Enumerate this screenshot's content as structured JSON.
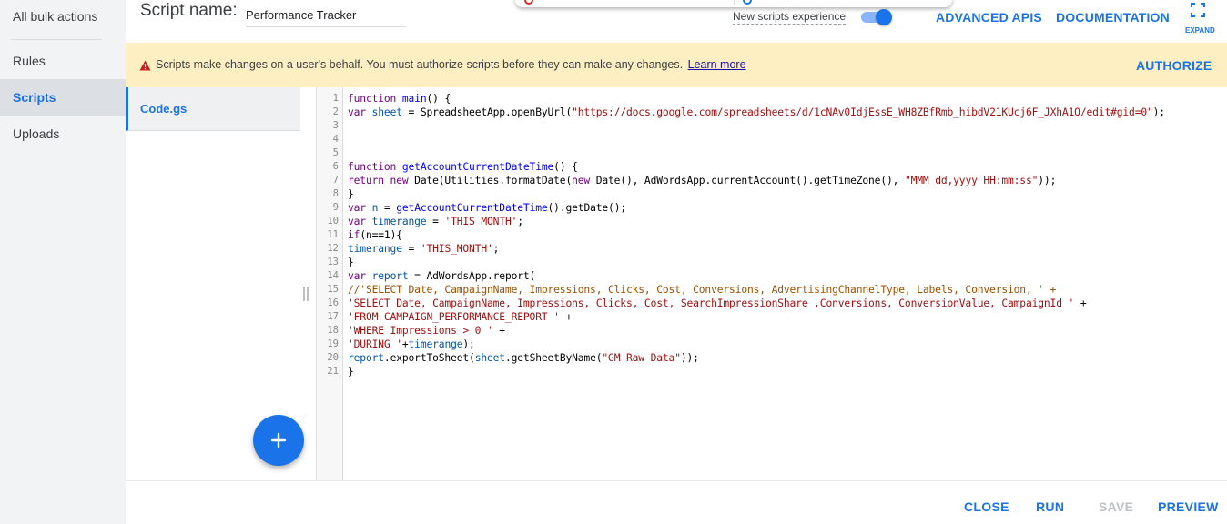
{
  "nav": {
    "items": [
      {
        "label": "All bulk actions",
        "active": false
      },
      {
        "label": "Rules",
        "active": false
      },
      {
        "label": "Scripts",
        "active": true
      },
      {
        "label": "Uploads",
        "active": false
      }
    ]
  },
  "header": {
    "script_name_label": "Script name:",
    "script_name_value": "Performance Tracker",
    "new_scripts_label": "New scripts experience",
    "new_scripts_enabled": true,
    "advanced_apis": "ADVANCED APIS",
    "documentation": "DOCUMENTATION",
    "expand_label": "EXPAND",
    "expand_icon": "fullscreen-icon"
  },
  "banner": {
    "icon": "warning-icon",
    "text": "Scripts make changes on a user's behalf. You must authorize scripts before they can make any changes.",
    "link": "Learn more",
    "authorize": "AUTHORIZE",
    "background": "#feefc3"
  },
  "files": {
    "items": [
      {
        "name": "Code.gs",
        "active": true
      }
    ],
    "add_icon": "plus-icon"
  },
  "editor": {
    "lines": [
      [
        [
          "function ",
          "k"
        ],
        [
          "main",
          "f"
        ],
        [
          "() {",
          "p"
        ]
      ],
      [
        [
          "var ",
          "k"
        ],
        [
          "sheet",
          "v"
        ],
        [
          " = SpreadsheetApp.openByUrl(",
          "p"
        ],
        [
          "\"https://docs.google.com/spreadsheets/d/1cNAv0IdjEssE_WH8ZBfRmb_hibdV21KUcj6F_JXhA1Q/edit#gid=0\"",
          "s"
        ],
        [
          ");",
          "p"
        ]
      ],
      [],
      [],
      [],
      [
        [
          "function ",
          "k"
        ],
        [
          "getAccountCurrentDateTime",
          "f"
        ],
        [
          "() {",
          "p"
        ]
      ],
      [
        [
          "return new ",
          "k"
        ],
        [
          "Date(Utilities.formatDate(",
          "p"
        ],
        [
          "new ",
          "k"
        ],
        [
          "Date(), AdWordsApp.currentAccount().getTimeZone(), ",
          "p"
        ],
        [
          "\"MMM dd,yyyy HH:mm:ss\"",
          "s"
        ],
        [
          "));",
          "p"
        ]
      ],
      [
        [
          "}",
          "p"
        ]
      ],
      [
        [
          "var ",
          "k"
        ],
        [
          "n",
          "v"
        ],
        [
          " = ",
          "p"
        ],
        [
          "getAccountCurrentDateTime",
          "f"
        ],
        [
          "().getDate();",
          "p"
        ]
      ],
      [
        [
          "var ",
          "k"
        ],
        [
          "timerange",
          "v"
        ],
        [
          " = ",
          "p"
        ],
        [
          "'THIS_MONTH'",
          "s"
        ],
        [
          ";",
          "p"
        ]
      ],
      [
        [
          "if",
          "k"
        ],
        [
          "(n==1){",
          "p"
        ]
      ],
      [
        [
          "timerange",
          "v"
        ],
        [
          " = ",
          "p"
        ],
        [
          "'THIS_MONTH'",
          "s"
        ],
        [
          ";",
          "p"
        ]
      ],
      [
        [
          "}",
          "p"
        ]
      ],
      [
        [
          "var ",
          "k"
        ],
        [
          "report",
          "v"
        ],
        [
          " = AdWordsApp.report(",
          "p"
        ]
      ],
      [
        [
          "//'SELECT Date, CampaignName, Impressions, Clicks, Cost, Conversions, AdvertisingChannelType, Labels, Conversion, ' +",
          "c"
        ]
      ],
      [
        [
          "'SELECT Date, CampaignName, Impressions, Clicks, Cost, SearchImpressionShare ,Conversions, ConversionValue, CampaignId '",
          "s"
        ],
        [
          " +",
          "p"
        ]
      ],
      [
        [
          "'FROM CAMPAIGN_PERFORMANCE_REPORT '",
          "s"
        ],
        [
          " +",
          "p"
        ]
      ],
      [
        [
          "'WHERE Impressions > 0 '",
          "s"
        ],
        [
          " +",
          "p"
        ]
      ],
      [
        [
          "'DURING '",
          "s"
        ],
        [
          "+",
          "p"
        ],
        [
          "timerange",
          "v"
        ],
        [
          ");",
          "p"
        ]
      ],
      [
        [
          "report",
          "v"
        ],
        [
          ".exportToSheet(",
          "p"
        ],
        [
          "sheet",
          "v"
        ],
        [
          ".getSheetByName(",
          "p"
        ],
        [
          "\"GM Raw Data\"",
          "s"
        ],
        [
          "));",
          "p"
        ]
      ],
      [
        [
          "}",
          "p"
        ]
      ]
    ],
    "colors": {
      "k": "#770088",
      "f": "#0000ff",
      "v": "#0055aa",
      "s": "#a11111",
      "c": "#a05000",
      "p": "#000000"
    }
  },
  "footer": {
    "close": "CLOSE",
    "run": "RUN",
    "save": "SAVE",
    "save_disabled": true,
    "preview": "PREVIEW"
  }
}
